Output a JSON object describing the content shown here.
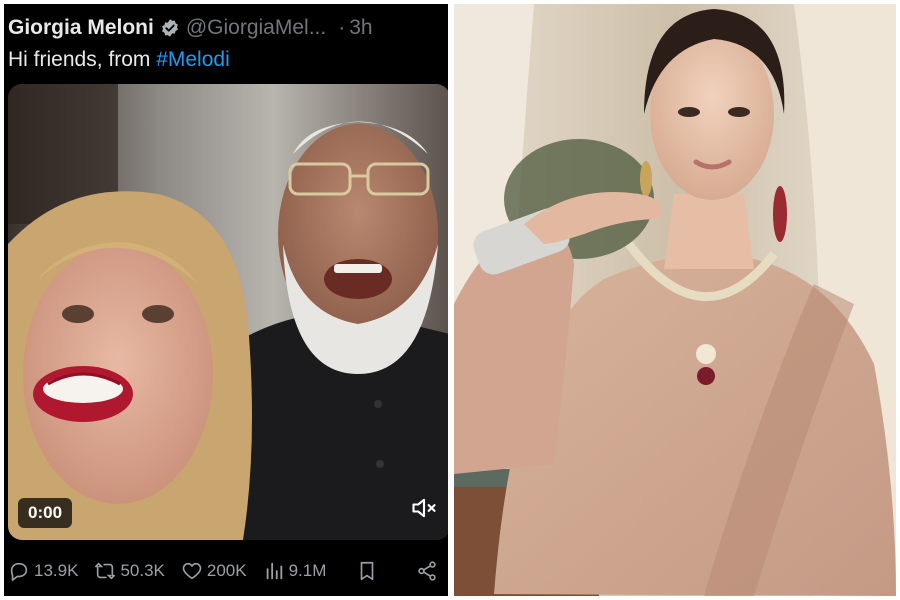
{
  "tweet": {
    "author_name": "Giorgia Meloni",
    "handle": "@GiorgiaMel...",
    "time_separator": "·",
    "time": "3h",
    "text_prefix": "Hi friends, from ",
    "hashtag": "#Melodi",
    "video": {
      "time_label": "0:00",
      "muted": true
    },
    "actions": {
      "replies": "13.9K",
      "reposts": "50.3K",
      "likes": "200K",
      "views": "9.1M"
    },
    "icons": [
      "verified-badge-icon",
      "reply-icon",
      "repost-icon",
      "like-icon",
      "views-icon",
      "bookmark-icon",
      "share-icon",
      "mute-icon"
    ],
    "colors": {
      "background": "#000000",
      "text": "#e7e9ea",
      "secondary_text": "#71767b",
      "link": "#1d9bf0"
    }
  }
}
